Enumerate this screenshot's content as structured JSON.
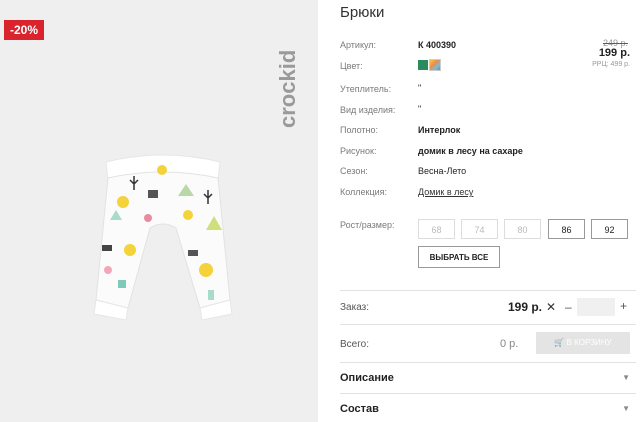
{
  "image": {
    "discount_badge": "-20%",
    "brand_logo": "crockid"
  },
  "product": {
    "title": "Брюки",
    "price": {
      "old": "249 р.",
      "current": "199 р.",
      "rrp": "РРЦ: 499 р."
    },
    "attributes": [
      {
        "label": "Артикул:",
        "value": "К 400390"
      },
      {
        "label": "Цвет:",
        "value": ""
      },
      {
        "label": "Утеплитель:",
        "value": "\""
      },
      {
        "label": "Вид изделия:",
        "value": "\""
      },
      {
        "label": "Полотно:",
        "value": "Интерлок"
      },
      {
        "label": "Рисунок:",
        "value": "домик в лесу на сахаре"
      },
      {
        "label": "Сезон:",
        "value": "Весна-Лето"
      },
      {
        "label": "Коллекция:",
        "value": "Домик в лесу"
      }
    ],
    "colors": [
      "#2a8b5f",
      "multicolor"
    ]
  },
  "sizes": {
    "label": "Рост/размер:",
    "options": [
      {
        "label": "68",
        "available": false
      },
      {
        "label": "74",
        "available": false
      },
      {
        "label": "80",
        "available": false
      },
      {
        "label": "86",
        "available": true
      },
      {
        "label": "92",
        "available": true
      }
    ],
    "select_all": "ВЫБРАТЬ ВСЕ"
  },
  "order": {
    "label": "Заказ:",
    "price": "199 р.",
    "times": "✕",
    "minus": "–",
    "plus": "+",
    "quantity": ""
  },
  "total": {
    "label": "Всего:",
    "value": "0 р.",
    "cart_button": "В КОРЗИНУ"
  },
  "accordions": [
    {
      "label": "Описание"
    },
    {
      "label": "Состав"
    }
  ],
  "colors_theme": {
    "accent": "#d9232d",
    "disabled_button": "#e4e4e4"
  }
}
